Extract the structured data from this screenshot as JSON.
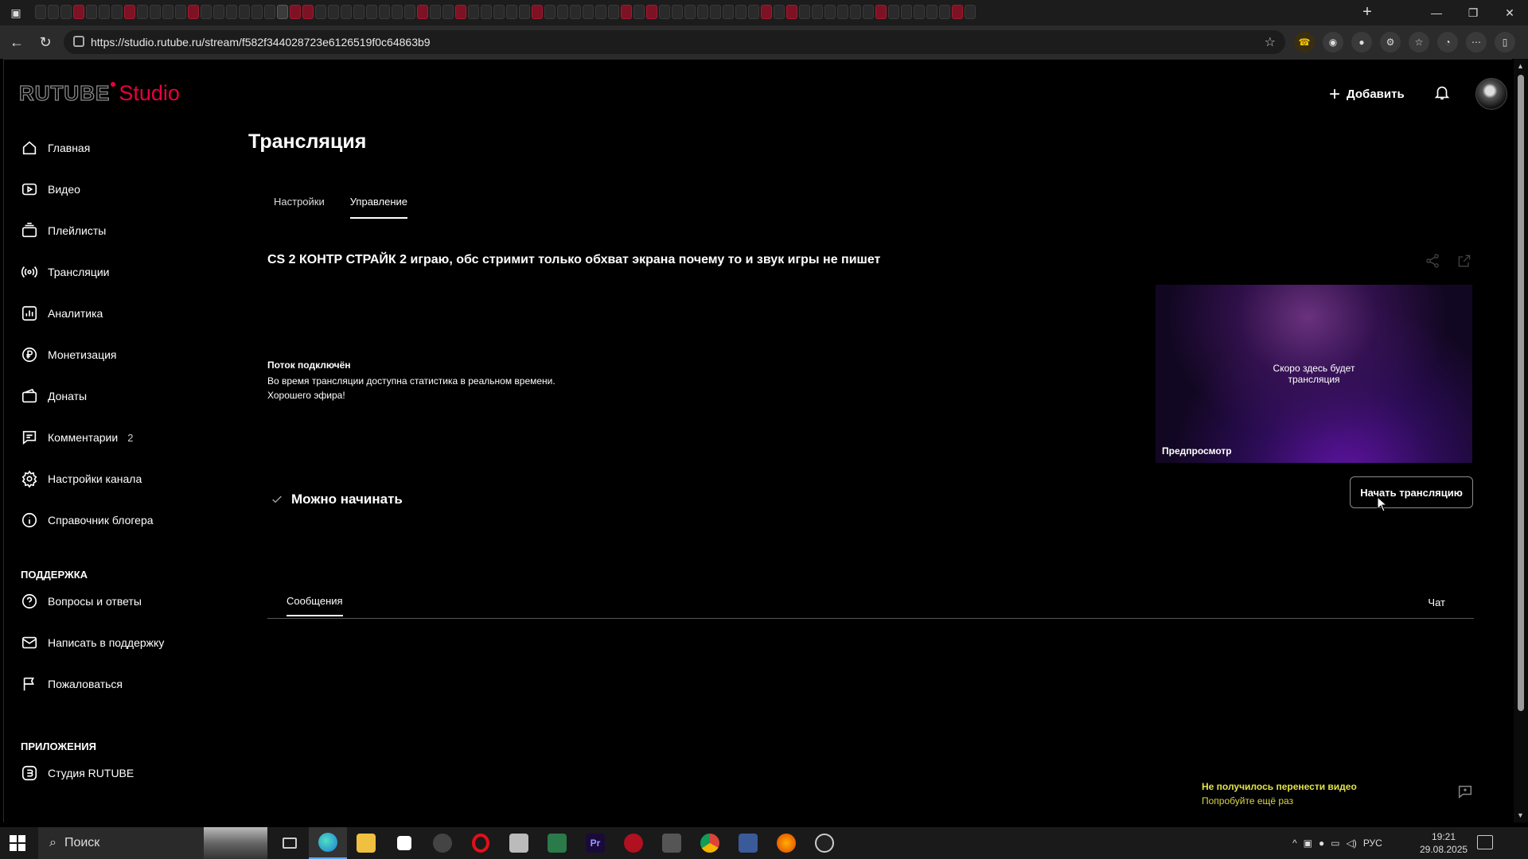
{
  "browser": {
    "url": "https://studio.rutube.ru/stream/f582f344028723e6126519f0c64863b9",
    "tab_count": 74
  },
  "logo": {
    "brand": "RUTUBE",
    "product": "Studio"
  },
  "header": {
    "add_label": "Добавить"
  },
  "sidebar": {
    "items": [
      {
        "label": "Главная",
        "icon": "home-icon"
      },
      {
        "label": "Видео",
        "icon": "video-icon"
      },
      {
        "label": "Плейлисты",
        "icon": "playlist-icon"
      },
      {
        "label": "Трансляции",
        "icon": "broadcast-icon"
      },
      {
        "label": "Аналитика",
        "icon": "analytics-icon"
      },
      {
        "label": "Монетизация",
        "icon": "ruble-icon"
      },
      {
        "label": "Донаты",
        "icon": "wallet-icon"
      },
      {
        "label": "Комментарии",
        "icon": "comment-icon",
        "badge": "2"
      },
      {
        "label": "Настройки канала",
        "icon": "gear-icon"
      },
      {
        "label": "Справочник блогера",
        "icon": "info-icon"
      }
    ],
    "support_heading": "ПОДДЕРЖКА",
    "support_items": [
      {
        "label": "Вопросы и ответы",
        "icon": "question-icon"
      },
      {
        "label": "Написать в поддержку",
        "icon": "mail-icon"
      },
      {
        "label": "Пожаловаться",
        "icon": "flag-icon"
      }
    ],
    "apps_heading": "ПРИЛОЖЕНИЯ",
    "apps_items": [
      {
        "label": "Студия RUTUBE",
        "icon": "studio-app-icon"
      }
    ]
  },
  "main": {
    "title": "Трансляция",
    "tabs": [
      "Настройки",
      "Управление"
    ],
    "active_tab": "Управление",
    "stream_title": "CS 2 КОНТР СТРАЙК 2 играю, обс стримит только обхват экрана почему то и звук игры не пишет",
    "status_heading": "Поток подключён",
    "status_line1": "Во время трансляции доступна статистика в реальном времени.",
    "status_line2": "Хорошего эфира!",
    "preview_soon": "Скоро здесь будет трансляция",
    "preview_label": "Предпросмотр",
    "ready_label": "Можно начинать",
    "start_button": "Начать трансляцию",
    "messages_tab": "Сообщения",
    "chat_tab": "Чат"
  },
  "notice": {
    "line1": "Не получилось перенести видео",
    "line2": "Попробуйте ещё раз"
  },
  "taskbar": {
    "search_label": "Поиск",
    "language": "РУС",
    "time": "19:21",
    "date": "29.08.2025"
  },
  "colors": {
    "accent": "#e8003d",
    "notice": "#e3e34a",
    "background": "#000000"
  }
}
